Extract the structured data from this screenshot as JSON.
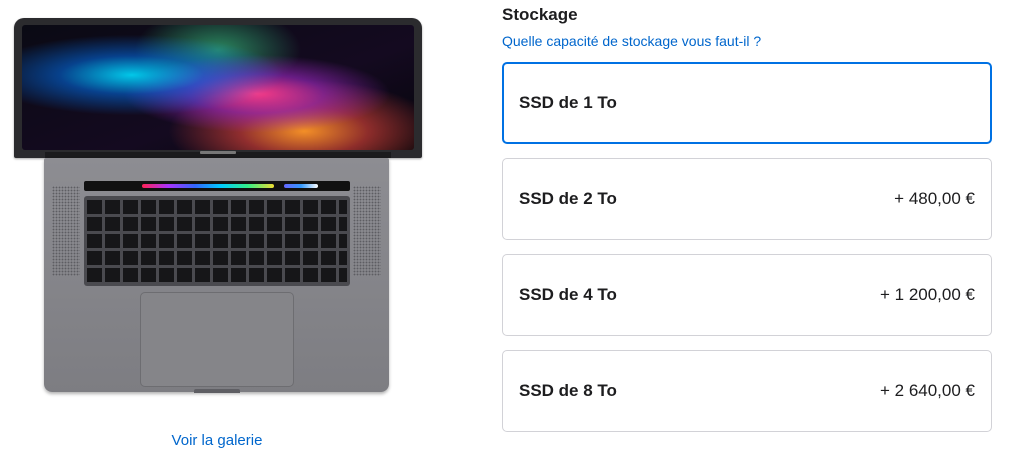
{
  "product": {
    "image_name": "MacBook Pro 16 space gray",
    "gallery_link": "Voir la galerie"
  },
  "storage": {
    "title": "Stockage",
    "help_link": "Quelle capacité de stockage vous faut-il ?",
    "selected_index": 0,
    "options": [
      {
        "label": "SSD de 1 To",
        "price": ""
      },
      {
        "label": "SSD de 2 To",
        "price": "+ 480,00 €"
      },
      {
        "label": "SSD de 4 To",
        "price": "+ 1 200,00 €"
      },
      {
        "label": "SSD de 8 To",
        "price": "+ 2 640,00 €"
      }
    ]
  },
  "colors": {
    "link": "#0066cc",
    "selected_border": "#0071e3",
    "option_border": "#d2d2d7",
    "laptop_body": "#7d7d82"
  }
}
